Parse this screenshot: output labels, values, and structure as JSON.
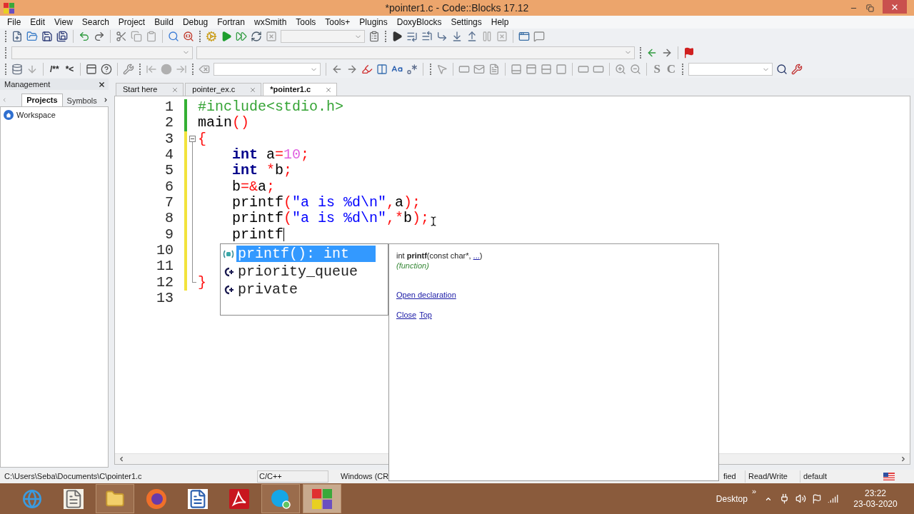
{
  "window": {
    "title": "*pointer1.c - Code::Blocks 17.12"
  },
  "menu": [
    "File",
    "Edit",
    "View",
    "Search",
    "Project",
    "Build",
    "Debug",
    "Fortran",
    "wxSmith",
    "Tools",
    "Tools+",
    "Plugins",
    "DoxyBlocks",
    "Settings",
    "Help"
  ],
  "toolbar": {
    "doxygen_buttons": [
      "/**",
      "*<"
    ],
    "spell_buttons": [
      "S",
      "C"
    ]
  },
  "management": {
    "title": "Management",
    "tabs": [
      {
        "label": "Projects",
        "selected": true
      },
      {
        "label": "Symbols",
        "selected": false
      }
    ],
    "tree": [
      {
        "label": "Workspace"
      }
    ]
  },
  "editor": {
    "tabs": [
      {
        "label": "Start here",
        "selected": false
      },
      {
        "label": "pointer_ex.c",
        "selected": false
      },
      {
        "label": "*pointer1.c",
        "selected": true
      }
    ],
    "lines": [
      {
        "number": "1",
        "kind": "saved",
        "fold_start": false,
        "fold_end": false,
        "caret": false,
        "tokens": [
          {
            "kind": "preprocessor",
            "text": "#include<stdio.h>"
          }
        ]
      },
      {
        "number": "2",
        "kind": "saved",
        "fold_start": false,
        "fold_end": false,
        "caret": false,
        "tokens": [
          {
            "kind": "identifier",
            "text": "main"
          },
          {
            "kind": "operator",
            "text": "()"
          }
        ]
      },
      {
        "number": "3",
        "kind": "modified",
        "fold_start": true,
        "fold_end": false,
        "caret": false,
        "tokens": [
          {
            "kind": "operator",
            "text": "{"
          }
        ]
      },
      {
        "number": "4",
        "kind": "modified",
        "fold_start": false,
        "fold_end": false,
        "caret": false,
        "tokens": [
          {
            "kind": "keyword",
            "text": "    int"
          },
          {
            "kind": "identifier",
            "text": " a"
          },
          {
            "kind": "operator",
            "text": "="
          },
          {
            "kind": "number",
            "text": "10"
          },
          {
            "kind": "operator",
            "text": ";"
          }
        ]
      },
      {
        "number": "5",
        "kind": "modified",
        "fold_start": false,
        "fold_end": false,
        "caret": false,
        "tokens": [
          {
            "kind": "keyword",
            "text": "    int "
          },
          {
            "kind": "operator",
            "text": "*"
          },
          {
            "kind": "identifier",
            "text": "b"
          },
          {
            "kind": "operator",
            "text": ";"
          }
        ]
      },
      {
        "number": "6",
        "kind": "modified",
        "fold_start": false,
        "fold_end": false,
        "caret": false,
        "tokens": [
          {
            "kind": "identifier",
            "text": "    b"
          },
          {
            "kind": "operator",
            "text": "=&"
          },
          {
            "kind": "identifier",
            "text": "a"
          },
          {
            "kind": "operator",
            "text": ";"
          }
        ]
      },
      {
        "number": "7",
        "kind": "modified",
        "fold_start": false,
        "fold_end": false,
        "caret": false,
        "tokens": [
          {
            "kind": "identifier",
            "text": "    printf"
          },
          {
            "kind": "operator",
            "text": "("
          },
          {
            "kind": "string",
            "text": "\"a is %d\\n\""
          },
          {
            "kind": "operator",
            "text": ","
          },
          {
            "kind": "identifier",
            "text": "a"
          },
          {
            "kind": "operator",
            "text": ");"
          }
        ]
      },
      {
        "number": "8",
        "kind": "modified",
        "fold_start": false,
        "fold_end": false,
        "caret": false,
        "tokens": [
          {
            "kind": "identifier",
            "text": "    printf"
          },
          {
            "kind": "operator",
            "text": "("
          },
          {
            "kind": "string",
            "text": "\"a is %d\\n\""
          },
          {
            "kind": "operator",
            "text": ",*"
          },
          {
            "kind": "identifier",
            "text": "b"
          },
          {
            "kind": "operator",
            "text": ");"
          }
        ]
      },
      {
        "number": "9",
        "kind": "modified",
        "fold_start": false,
        "fold_end": false,
        "caret": true,
        "tokens": [
          {
            "kind": "identifier",
            "text": "    printf"
          }
        ]
      },
      {
        "number": "10",
        "kind": "modified",
        "fold_start": false,
        "fold_end": false,
        "caret": false
      },
      {
        "number": "11",
        "kind": "modified",
        "fold_start": false,
        "fold_end": false,
        "caret": false
      },
      {
        "number": "12",
        "kind": "modified",
        "fold_start": false,
        "fold_end": true,
        "caret": false,
        "tokens": [
          {
            "kind": "operator",
            "text": "}"
          }
        ]
      },
      {
        "number": "13",
        "kind": "unchanged",
        "fold_start": false,
        "fold_end": false,
        "caret": false
      }
    ]
  },
  "completion": {
    "items": [
      {
        "label": "printf(): int",
        "kind": "function",
        "selected": true
      },
      {
        "label": "priority_queue",
        "kind": "class",
        "selected": false
      },
      {
        "label": "private",
        "kind": "class",
        "selected": false
      }
    ]
  },
  "doc_popup": {
    "signature": "int **printf**(const char*, ",
    "signature_link": "...",
    "signature_end": ")",
    "category": "(function)",
    "links": [
      "Open declaration"
    ],
    "footer_links": [
      "Close",
      "Top"
    ]
  },
  "status_bar": {
    "file_path": "C:\\Users\\Seba\\Documents\\C\\pointer1.c",
    "language": "C/C++",
    "line_endings": "Windows (CR",
    "modified": "fied",
    "access": "Read/Write",
    "profile": "default"
  },
  "taskbar": {
    "apps": [
      {
        "running": false,
        "active": false
      },
      {
        "running": false,
        "active": false
      },
      {
        "running": true,
        "active": false
      },
      {
        "running": false,
        "active": false
      },
      {
        "running": false,
        "active": false
      },
      {
        "running": false,
        "active": false
      },
      {
        "running": true,
        "active": false
      },
      {
        "running": true,
        "active": true
      }
    ],
    "desktop_label": "Desktop",
    "overflow": "»",
    "time": "23:22",
    "date": "23-03-2020"
  }
}
